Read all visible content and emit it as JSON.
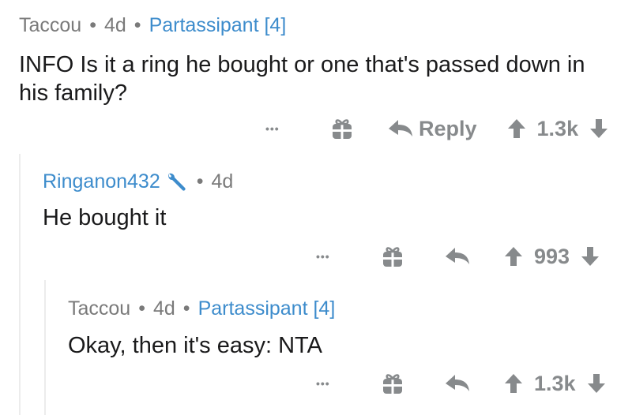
{
  "comments": [
    {
      "author": "Taccou",
      "age": "4d",
      "flair": "Partassipant [4]",
      "text": "INFO Is it a ring he bought or one that's passed down in his family?",
      "reply_label": "Reply",
      "score": "1.3k"
    },
    {
      "author": "Ringanon432",
      "age": "4d",
      "text": "He bought it",
      "score": "993"
    },
    {
      "author": "Taccou",
      "age": "4d",
      "flair": "Partassipant [4]",
      "text": "Okay, then it's easy: NTA",
      "score": "1.3k"
    }
  ],
  "separator": "•",
  "more_label": "•••",
  "icons": {
    "more": "more-options-icon",
    "gift": "gift-award-icon",
    "reply": "reply-arrow-icon",
    "upvote": "upvote-arrow-icon",
    "downvote": "downvote-arrow-icon",
    "mod": "mod-wrench-icon"
  },
  "colors": {
    "flair": "#3d8ccc",
    "meta": "#7a7a7a",
    "action": "#878a8c",
    "text": "#1a1a1b"
  }
}
